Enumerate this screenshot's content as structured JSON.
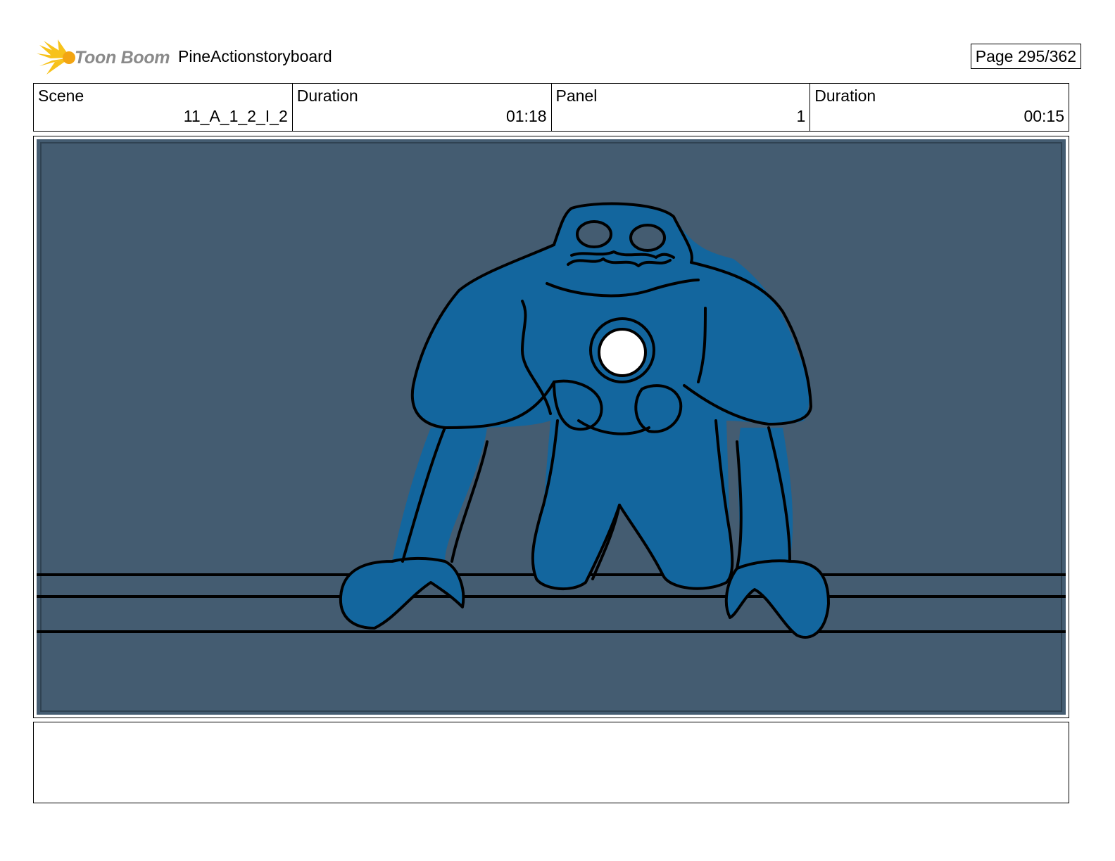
{
  "header": {
    "logo_text": "Toon Boom",
    "project_title": "PineActionstoryboard",
    "page_label": "Page 295/362"
  },
  "info": {
    "scene_label": "Scene",
    "scene_value": "11_A_1_2_I_2",
    "scene_duration_label": "Duration",
    "scene_duration_value": "01:18",
    "panel_label": "Panel",
    "panel_value": "1",
    "panel_duration_label": "Duration",
    "panel_duration_value": "00:15"
  },
  "panel": {
    "background_color": "#445c71",
    "character_color": "#13669e",
    "line_color": "#000000",
    "logo_accent_color": "#f7c21b"
  },
  "notes": {
    "text": ""
  }
}
